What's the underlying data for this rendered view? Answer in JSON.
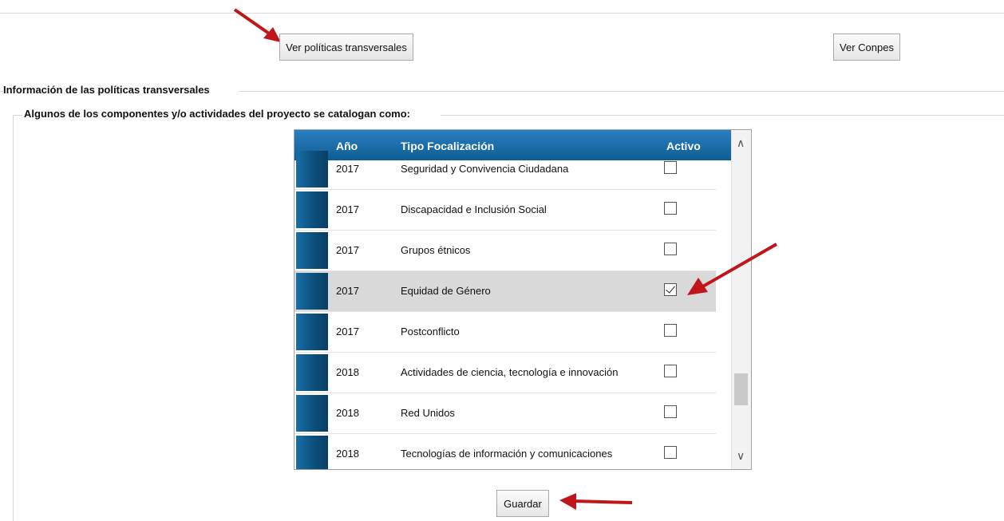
{
  "buttons": {
    "ver_politicas": "Ver políticas transversales",
    "ver_conpes": "Ver Conpes",
    "guardar": "Guardar"
  },
  "fieldsets": {
    "outer_legend": "Información de las políticas transversales",
    "inner_legend": "Algunos de los componentes y/o actividades del proyecto se catalogan como:"
  },
  "grid": {
    "columns": [
      "Año",
      "Tipo Focalización",
      "Activo"
    ],
    "rows": [
      {
        "year": "2017",
        "tipo": "Seguridad y Convivencia Ciudadana",
        "activo": false
      },
      {
        "year": "2017",
        "tipo": "Discapacidad e Inclusión Social",
        "activo": false
      },
      {
        "year": "2017",
        "tipo": "Grupos étnicos",
        "activo": false
      },
      {
        "year": "2017",
        "tipo": "Equidad de Género",
        "activo": true,
        "selected": true
      },
      {
        "year": "2017",
        "tipo": "Postconflicto",
        "activo": false
      },
      {
        "year": "2018",
        "tipo": "Actividades de ciencia, tecnología e innovación",
        "activo": false
      },
      {
        "year": "2018",
        "tipo": "Red Unidos",
        "activo": false
      },
      {
        "year": "2018",
        "tipo": "Tecnologías de información y comunicaciones",
        "activo": false
      }
    ]
  },
  "icons": {
    "annotation_arrow_color": "#c0161b",
    "header_color": "#1670ad",
    "scroll_up": "chevron-up-icon",
    "scroll_down": "chevron-down-icon"
  }
}
